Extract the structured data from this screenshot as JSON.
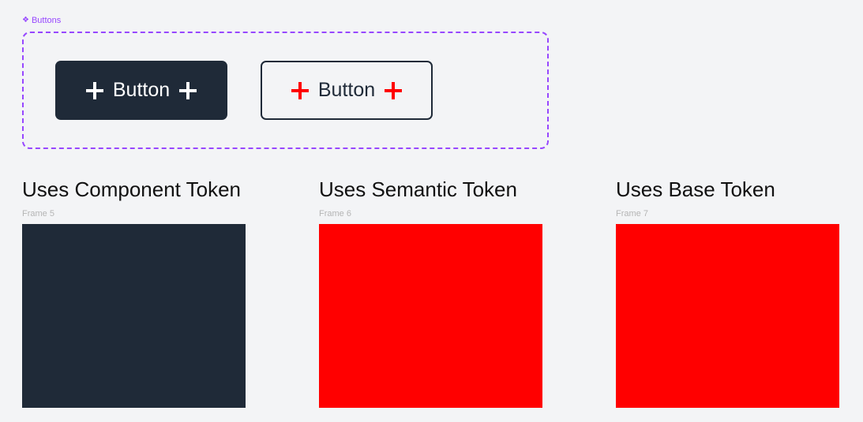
{
  "component_set": {
    "label": "Buttons",
    "icon": "component-diamond-icon",
    "border_color": "#9747ff"
  },
  "buttons": [
    {
      "label": "Button",
      "variant": "primary",
      "background": "#1f2a38",
      "text_color": "#ffffff",
      "icon_color": "#ffffff",
      "leading_icon": "plus-icon",
      "trailing_icon": "plus-icon"
    },
    {
      "label": "Button",
      "variant": "secondary",
      "background": "#f3f4f6",
      "text_color": "#1f2a38",
      "icon_color": "#ff0000",
      "leading_icon": "plus-icon",
      "trailing_icon": "plus-icon"
    }
  ],
  "sections": [
    {
      "title": "Uses Component Token",
      "frame_label": "Frame 5",
      "fill": "#1f2a38"
    },
    {
      "title": "Uses Semantic Token",
      "frame_label": "Frame 6",
      "fill": "#ff0000"
    },
    {
      "title": "Uses Base Token",
      "frame_label": "Frame 7",
      "fill": "#ff0000"
    }
  ]
}
